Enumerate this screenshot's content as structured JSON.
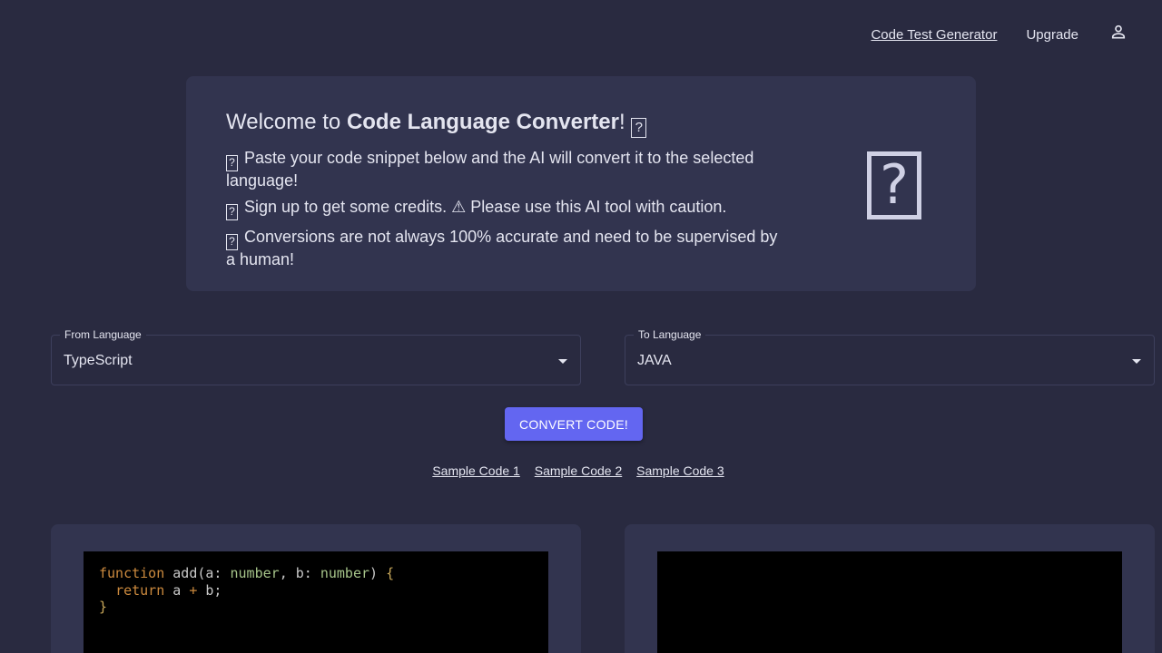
{
  "nav": {
    "code_test_generator": "Code Test Generator",
    "upgrade": "Upgrade",
    "user_icon": "user-icon"
  },
  "welcome": {
    "title_prefix": "Welcome to ",
    "title_bold": "Code Language Converter",
    "title_suffix": "!",
    "line1": "Paste your code snippet below and the AI will convert it to the selected language!",
    "line2": "Sign up to get some credits. ⚠ Please use this AI tool with caution.",
    "line3": "Conversions are not always 100% accurate and need to be supervised by a human!",
    "missing_glyph": "?"
  },
  "from_select": {
    "label": "From Language",
    "value": "TypeScript"
  },
  "to_select": {
    "label": "To Language",
    "value": "JAVA"
  },
  "convert_button": "CONVERT CODE!",
  "samples": [
    "Sample Code 1",
    "Sample Code 2",
    "Sample Code 3"
  ],
  "code": {
    "input_lines": [
      "function add(a: number, b: number) {",
      "  return a + b;",
      "}"
    ],
    "output": ""
  },
  "colors": {
    "background": "#292a40",
    "card": "#32344f",
    "accent": "#6366f1",
    "code_background": "#000000"
  }
}
